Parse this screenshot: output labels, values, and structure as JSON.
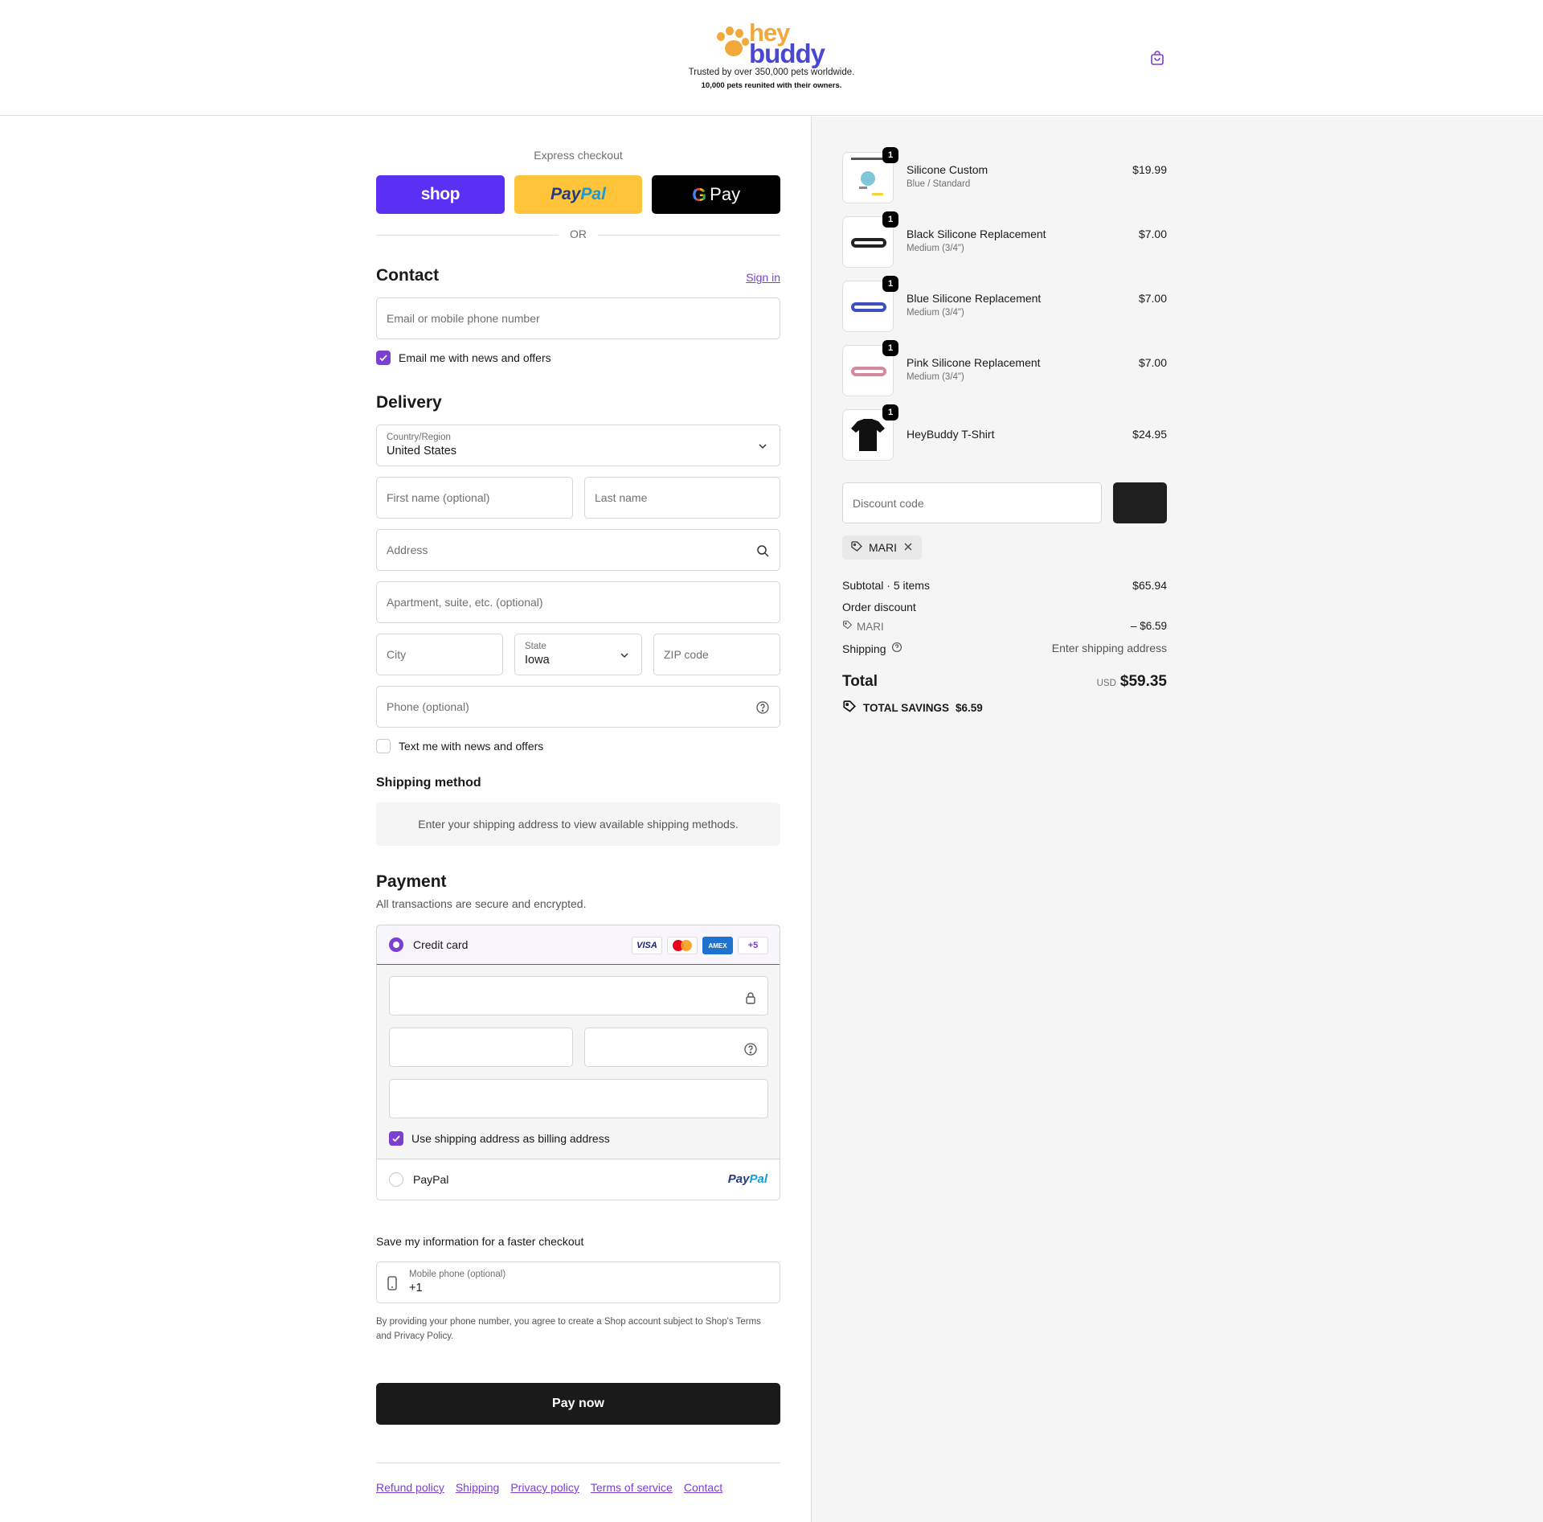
{
  "header": {
    "logo_top": "hey",
    "logo_bottom": "buddy",
    "tagline": "Trusted by over 350,000 pets worldwide.",
    "subtagline": "10,000 pets reunited with their owners.",
    "cart_icon": "bag-icon",
    "colors": {
      "brand_orange": "#f2a93b",
      "brand_blue": "#4a48cf",
      "accent": "#7b3fd1"
    }
  },
  "express": {
    "title": "Express checkout",
    "buttons": [
      {
        "label": "shop",
        "color": "#5a31f4"
      },
      {
        "label_a": "Pay",
        "label_b": "Pal",
        "color": "#ffc439"
      },
      {
        "label_g": "G",
        "label": "Pay",
        "color": "#000000"
      }
    ],
    "or": "OR"
  },
  "contact": {
    "heading": "Contact",
    "sign_in": "Sign in",
    "email_placeholder": "Email or mobile phone number",
    "news_label": "Email me with news and offers",
    "news_checked": true
  },
  "delivery": {
    "heading": "Delivery",
    "country_label": "Country/Region",
    "country_value": "United States",
    "first_name_ph": "First name (optional)",
    "last_name_ph": "Last name",
    "address_ph": "Address",
    "apartment_ph": "Apartment, suite, etc. (optional)",
    "city_ph": "City",
    "state_label": "State",
    "state_value": "Iowa",
    "zip_ph": "ZIP code",
    "phone_ph": "Phone (optional)",
    "text_label": "Text me with news and offers",
    "text_checked": false
  },
  "shipping_method": {
    "heading": "Shipping method",
    "message": "Enter your shipping address to view available shipping methods."
  },
  "payment": {
    "heading": "Payment",
    "subtitle": "All transactions are secure and encrypted.",
    "credit_card_label": "Credit card",
    "cards": [
      "VISA",
      "mastercard",
      "AMEX",
      "+5"
    ],
    "billing_label": "Use shipping address as billing address",
    "billing_checked": true,
    "paypal_label": "PayPal",
    "paypal_logo_a": "Pay",
    "paypal_logo_b": "Pal"
  },
  "save": {
    "title": "Save my information for a faster checkout",
    "phone_label": "Mobile phone (optional)",
    "phone_value": "+1",
    "legal_text": "By providing your phone number, you agree to create a Shop account subject to Shop's",
    "terms": "Terms",
    "and": "and",
    "privacy": "Privacy Policy",
    "period": "."
  },
  "pay_now": "Pay now",
  "footer_links": [
    "Refund policy",
    "Shipping",
    "Privacy policy",
    "Terms of service",
    "Contact"
  ],
  "order": {
    "items": [
      {
        "qty": "1",
        "name": "Silicone Custom",
        "variant": "Blue / Standard",
        "price": "$19.99"
      },
      {
        "qty": "1",
        "name": "Black Silicone Replacement",
        "variant": "Medium (3/4\")",
        "price": "$7.00",
        "color": "#222222"
      },
      {
        "qty": "1",
        "name": "Blue Silicone Replacement",
        "variant": "Medium (3/4\")",
        "price": "$7.00",
        "color": "#3d4fc4"
      },
      {
        "qty": "1",
        "name": "Pink Silicone Replacement",
        "variant": "Medium (3/4\")",
        "price": "$7.00",
        "color": "#d58a9b"
      },
      {
        "qty": "1",
        "name": "HeyBuddy T-Shirt",
        "variant": "",
        "price": "$24.95"
      }
    ],
    "discount_placeholder": "Discount code",
    "applied_code": "MARI",
    "subtotal_label": "Subtotal · 5 items",
    "subtotal_value": "$65.94",
    "order_discount_label": "Order discount",
    "discount_code": "MARI",
    "discount_value": "– $6.59",
    "shipping_label": "Shipping",
    "shipping_value": "Enter shipping address",
    "total_label": "Total",
    "currency": "USD",
    "total_value": "$59.35",
    "savings_label": "TOTAL SAVINGS",
    "savings_value": "$6.59"
  }
}
